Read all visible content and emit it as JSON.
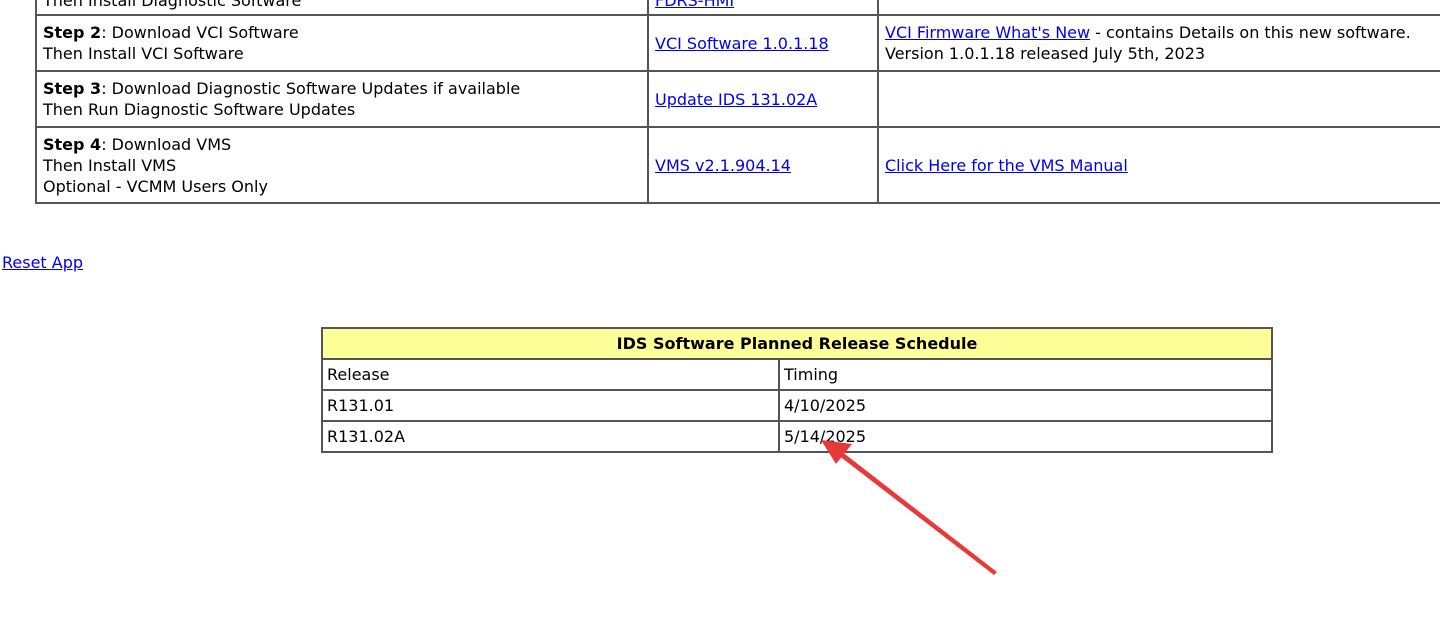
{
  "steps": {
    "row0": {
      "text": "Then Install Diagnostic Software",
      "link": "FDRS-HMI"
    },
    "row1": {
      "step_label": "Step 2",
      "line1": ": Download VCI Software",
      "line2": "Then Install VCI Software",
      "link": "VCI Software 1.0.1.18",
      "note_link": "VCI Firmware What's New",
      "note_text": " - contains Details on this new software.",
      "note_line2": "Version 1.0.1.18 released July 5th, 2023"
    },
    "row2": {
      "step_label": "Step 3",
      "line1": ": Download Diagnostic Software Updates if available",
      "line2": "Then Run Diagnostic Software Updates",
      "link": "Update IDS 131.02A"
    },
    "row3": {
      "step_label": "Step 4",
      "line1": ": Download VMS",
      "line2": "Then Install VMS",
      "line3": "Optional - VCMM Users Only",
      "link": "VMS v2.1.904.14",
      "note_link": "Click Here for the VMS Manual"
    }
  },
  "reset_link": "Reset App",
  "schedule": {
    "title": "IDS Software Planned Release Schedule",
    "header": {
      "release": "Release",
      "timing": "Timing"
    },
    "rows": [
      {
        "release": "R131.01",
        "timing": "4/10/2025"
      },
      {
        "release": "R131.02A",
        "timing": "5/14/2025"
      }
    ]
  },
  "colors": {
    "link": "#0000ee",
    "header_bg": "#ffff99",
    "arrow": "#e8393a"
  }
}
